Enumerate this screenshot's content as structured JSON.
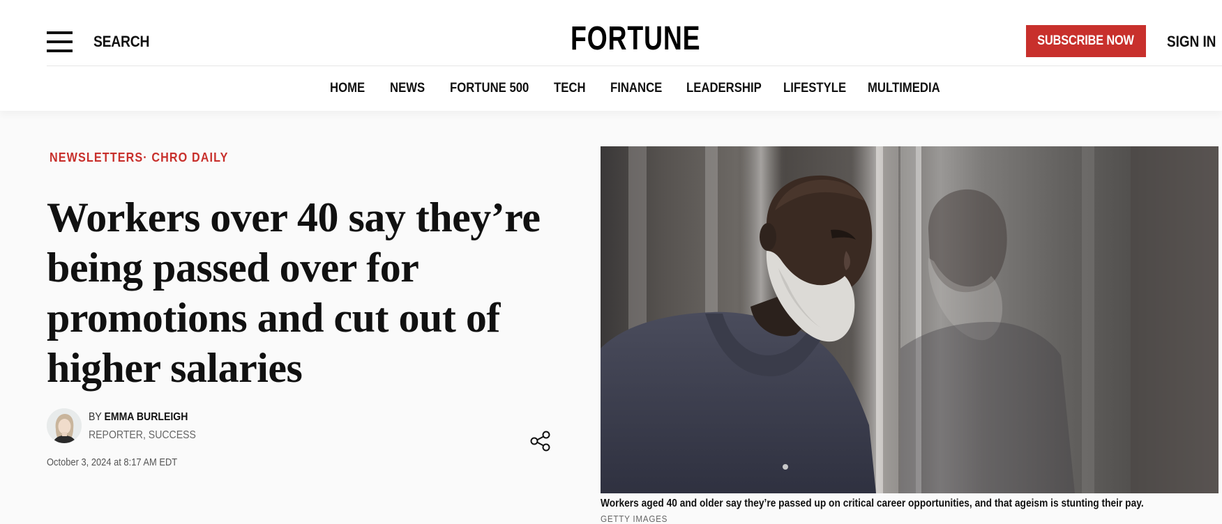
{
  "header": {
    "search_label": "SEARCH",
    "logo_text": "FORTUNE",
    "subscribe_label": "SUBSCRIBE NOW",
    "signin_label": "SIGN IN"
  },
  "nav": {
    "items": [
      "HOME",
      "NEWS",
      "FORTUNE 500",
      "TECH",
      "FINANCE",
      "LEADERSHIP",
      "LIFESTYLE",
      "MULTIMEDIA"
    ]
  },
  "article": {
    "section": "NEWSLETTERS",
    "separator": "·",
    "subsection": "CHRO DAILY",
    "headline": "Workers over 40 say they’re being passed over for promotions and cut out of higher salaries",
    "byline_prefix": "BY",
    "author_name": "EMMA BURLEIGH",
    "author_role": "REPORTER, SUCCESS",
    "date": "October 3, 2024 at 8:17 AM EDT",
    "image_caption": "Workers aged 40 and older say they’re passed up on critical career opportunities, and that ageism is stunting their pay.",
    "image_credit": "GETTY IMAGES"
  },
  "icons": {
    "menu": "hamburger-menu-icon",
    "share": "share-icon"
  },
  "colors": {
    "brand_red": "#c8302c",
    "text": "#111111",
    "page_bg": "#fafafa"
  }
}
